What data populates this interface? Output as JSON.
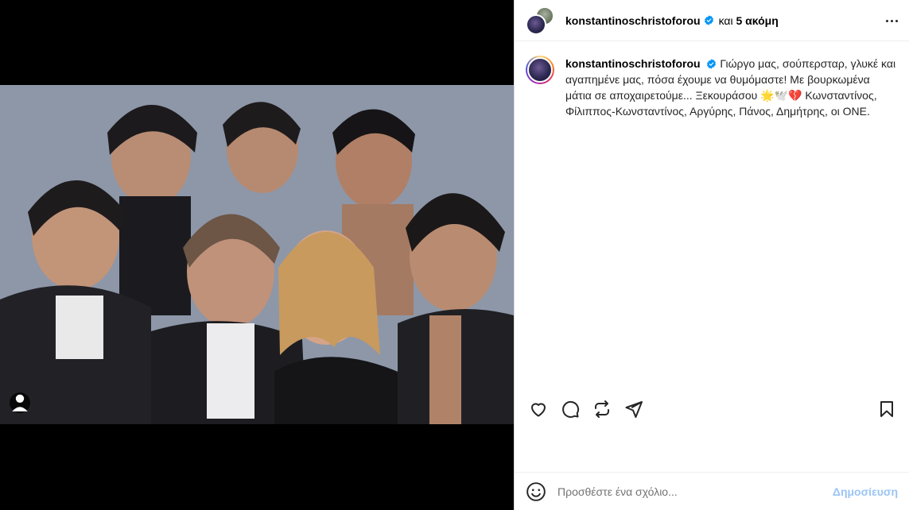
{
  "header": {
    "username": "konstantinoschristoforou",
    "coauthors": "και ",
    "coauthors_count": "5 ακόμη"
  },
  "caption": {
    "username": "konstantinoschristoforou",
    "text": "Γιώργο μας, σούπερσταρ, γλυκέ και αγαπημένε μας, πόσα έχουμε να θυμόμαστε! Με βουρκωμένα μάτια σε αποχαιρετούμε... Ξεκουράσου 🌟🕊️💔 Κωνσταντίνος, Φίλιππος-Κωνσταντίνος, Αργύρης, Πάνος, Δημήτρης, οι ONE."
  },
  "comment": {
    "placeholder": "Προσθέστε ένα σχόλιο...",
    "post_label": "Δημοσίευση"
  },
  "icons": {
    "like": "heart-icon",
    "comment": "comment-icon",
    "share_repost": "repost-icon",
    "send": "send-icon",
    "save": "bookmark-icon",
    "tag": "user-tag-icon",
    "emoji": "emoji-icon",
    "more": "more-options-icon"
  },
  "colors": {
    "verified": "#0095f6",
    "post_button_disabled": "#9ac5f5"
  }
}
